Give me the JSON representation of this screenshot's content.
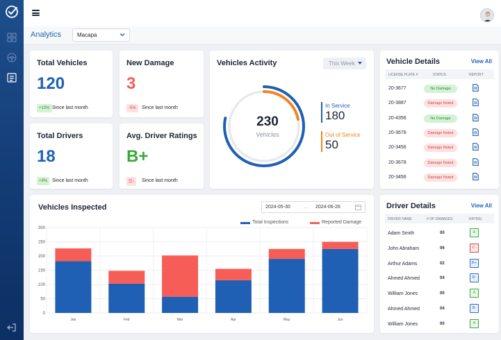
{
  "header": {
    "section_title": "Analytics",
    "region": "Macapa"
  },
  "kpis": [
    {
      "title": "Total Vehicles",
      "value": "120",
      "badge": "+10%",
      "since": "Since last month"
    },
    {
      "title": "New Damage",
      "value": "3",
      "badge": "-5%",
      "since": "Since last month"
    },
    {
      "title": "Total Drivers",
      "value": "18",
      "badge": "+8%",
      "since": "Since last month"
    },
    {
      "title": "Avg. Driver Ratings",
      "value": "B+",
      "badge": "☲↓",
      "since": "Since last month"
    }
  ],
  "activity": {
    "title": "Vehicles Activity",
    "period": "This Week",
    "total": "230",
    "total_label": "Vehicles",
    "in_service_label": "In Service",
    "in_service": "180",
    "out_service_label": "Out of Service",
    "out_service": "50"
  },
  "vehicle_details": {
    "title": "Vehicle Details",
    "view_all": "View All",
    "headers": [
      "LICENSE PLATE #",
      "STATUS",
      "REPORT"
    ],
    "rows": [
      {
        "plate": "20-3677",
        "status": "No Damage"
      },
      {
        "plate": "20-3887",
        "status": "Damage Noted"
      },
      {
        "plate": "20-4356",
        "status": "No Damage"
      },
      {
        "plate": "20-3678",
        "status": "Damage Noted"
      },
      {
        "plate": "20-3456",
        "status": "Damage Noted"
      },
      {
        "plate": "20-3678",
        "status": "Damage Noted"
      },
      {
        "plate": "20-3456",
        "status": "Damage Noted"
      }
    ]
  },
  "driver_details": {
    "title": "Driver Details",
    "view_all": "View All",
    "headers": [
      "DRIVER NAME",
      "# OF DAMAGES",
      "RATING"
    ],
    "rows": [
      {
        "name": "Adam Smith",
        "damages": "00",
        "rating": "A"
      },
      {
        "name": "John Abraham",
        "damages": "06",
        "rating": "C-"
      },
      {
        "name": "Arthur Adams",
        "damages": "02",
        "rating": "B+"
      },
      {
        "name": "Ahmed Ahmed",
        "damages": "04",
        "rating": "B-"
      },
      {
        "name": "William Jones",
        "damages": "00",
        "rating": "A"
      },
      {
        "name": "Ahmed Ahmed",
        "damages": "04",
        "rating": "B-"
      },
      {
        "name": "William Jones",
        "damages": "00",
        "rating": "A"
      }
    ]
  },
  "inspected": {
    "title": "Vehicles Inspected",
    "date_from": "2024-05-30",
    "date_to": "2024-06-26"
  },
  "colors": {
    "blue": "#1f5fb4",
    "red": "#f65d57",
    "green": "#3aa83a",
    "orange": "#f58220"
  },
  "chart_data": {
    "type": "bar",
    "stacked": true,
    "categories": [
      "Jan",
      "Feb",
      "Mar",
      "Apr",
      "May",
      "Jun"
    ],
    "series": [
      {
        "name": "Total Inspections",
        "values": [
          182,
          103,
          57,
          115,
          190,
          225
        ]
      },
      {
        "name": "Reported Damage",
        "values": [
          45,
          45,
          145,
          40,
          35,
          25
        ]
      }
    ],
    "ylim": [
      0,
      300
    ],
    "yticks": [
      0,
      50,
      100,
      150,
      200,
      250,
      300
    ],
    "legend": "top-right",
    "grid": true
  }
}
